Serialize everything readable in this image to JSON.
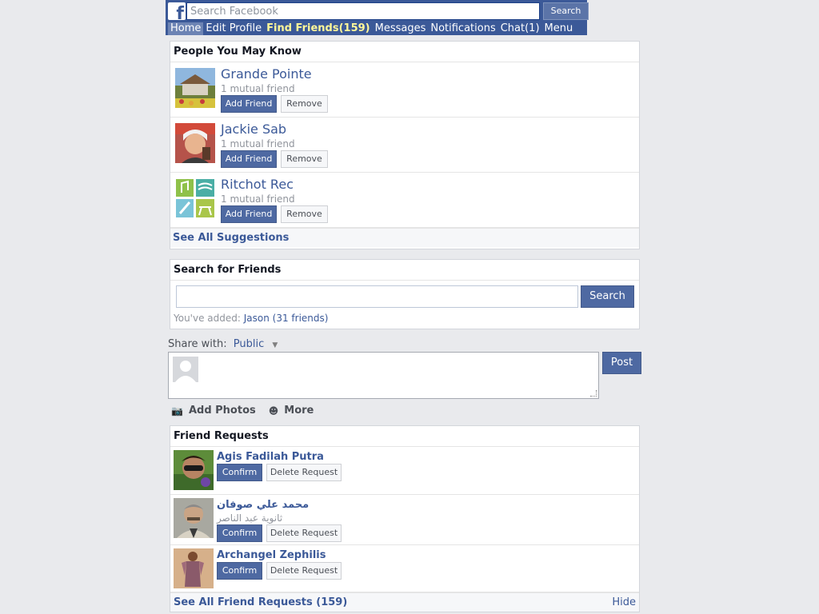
{
  "header": {
    "search_placeholder": "Search Facebook",
    "search_button": "Search",
    "nav": [
      {
        "label": "Home"
      },
      {
        "label": "Edit Profile"
      },
      {
        "label": "Find Friends(159)"
      },
      {
        "label": "Messages"
      },
      {
        "label": "Notifications"
      },
      {
        "label": "Chat(1)"
      },
      {
        "label": "Menu"
      }
    ]
  },
  "pymk": {
    "title": "People You May Know",
    "people": [
      {
        "name": "Grande Pointe",
        "mutual": "1 mutual friend",
        "add": "Add Friend",
        "remove": "Remove"
      },
      {
        "name": "Jackie Sab",
        "mutual": "1 mutual friend",
        "add": "Add Friend",
        "remove": "Remove"
      },
      {
        "name": "Ritchot Rec",
        "mutual": "1 mutual friend",
        "add": "Add Friend",
        "remove": "Remove"
      }
    ],
    "see_all": "See All Suggestions"
  },
  "search_friends": {
    "title": "Search for Friends",
    "value": "",
    "button": "Search",
    "added_prefix": "You've added:",
    "added_link": "Jason (31 friends)"
  },
  "composer": {
    "share_with_label": "Share with:",
    "audience": "Public",
    "post_button": "Post",
    "actions": [
      {
        "label": "Add Photos",
        "icon": "camera-icon"
      },
      {
        "label": "More",
        "icon": "smiley-icon"
      }
    ]
  },
  "friend_requests": {
    "title": "Friend Requests",
    "requests": [
      {
        "name": "Agis Fadilah Putra",
        "sub": "",
        "confirm": "Confirm",
        "delete": "Delete Request"
      },
      {
        "name": "محمد علي صوفان",
        "sub": "ثانوية عبد الناصر",
        "confirm": "Confirm",
        "delete": "Delete Request"
      },
      {
        "name": "Archangel Zephilis",
        "sub": "",
        "confirm": "Confirm",
        "delete": "Delete Request"
      }
    ],
    "see_all": "See All Friend Requests (159)",
    "hide": "Hide"
  },
  "colors": {
    "brand": "#3b5998",
    "button": "#4e69a2",
    "find_friends_highlight": "#fff799",
    "page_bg": "#e9eaed"
  }
}
